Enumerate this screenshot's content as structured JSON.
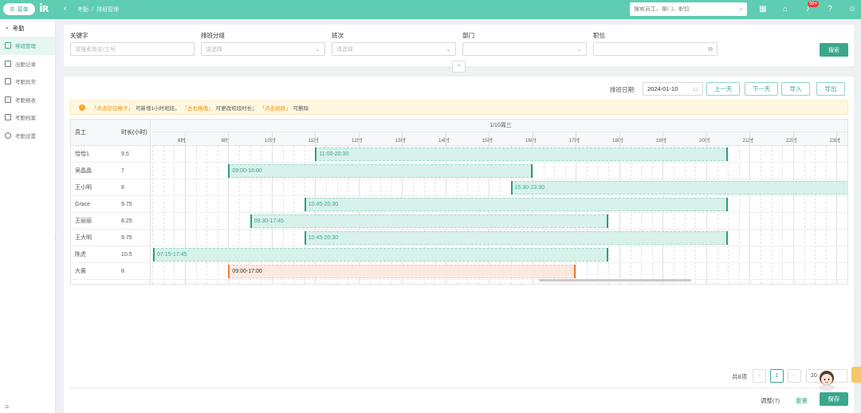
{
  "topbar": {
    "menu_label": "菜单",
    "logo": "i’R",
    "breadcrumb": [
      "考勤",
      "排班管理"
    ],
    "search_placeholder": "搜索员工、部门、职位",
    "notification_count": "99+"
  },
  "sidebar": {
    "section": "考勤",
    "items": [
      {
        "label": "排班管理",
        "active": true
      },
      {
        "label": "出勤记录"
      },
      {
        "label": "考勤异常"
      },
      {
        "label": "考勤报表"
      },
      {
        "label": "考勤档案"
      },
      {
        "label": "考勤设置"
      }
    ]
  },
  "filters": {
    "keyword": {
      "label": "关键字",
      "placeholder": "请搜索姓名/工号"
    },
    "group": {
      "label": "排班分组",
      "placeholder": "请选择"
    },
    "shift": {
      "label": "班次",
      "placeholder": "请选择"
    },
    "department": {
      "label": "部门",
      "placeholder": ""
    },
    "position": {
      "label": "职位",
      "placeholder": ""
    },
    "search_btn": "搜索"
  },
  "toolbar": {
    "date_label": "排班日期:",
    "date_value": "2024-01-10",
    "prev_day": "上一天",
    "next_day": "下一天",
    "import": "导入",
    "export": "导出"
  },
  "tip": {
    "p1": "「点击空白格子」",
    "p2": "可新增1小时班段。",
    "p3": "「左右拖拽」",
    "p4": "可更改班段时长；",
    "p5": "「点击班段」",
    "p6": "可删除"
  },
  "grid": {
    "col_employee": "员工",
    "col_duration": "时长(小时)",
    "date_header": "1/10周三",
    "hours": [
      "8时",
      "9时",
      "10时",
      "11时",
      "12时",
      "13时",
      "14时",
      "15时",
      "16时",
      "17时",
      "18时",
      "19时",
      "20时",
      "21时",
      "22时",
      "23时"
    ],
    "rows": [
      {
        "name": "恰恰1",
        "duration": "9.5",
        "shift": "11:00-20:30",
        "start": 11.0,
        "end": 20.5,
        "color": "green"
      },
      {
        "name": "吴晶晶",
        "duration": "7",
        "shift": "09:00-16:00",
        "start": 9.0,
        "end": 16.0,
        "color": "green"
      },
      {
        "name": "王小明",
        "duration": "8",
        "shift": "15:30-23:30",
        "start": 15.5,
        "end": 23.5,
        "color": "green"
      },
      {
        "name": "Grace",
        "duration": "9.75",
        "shift": "10:45-20:30",
        "start": 10.75,
        "end": 20.5,
        "color": "green"
      },
      {
        "name": "王丽丽",
        "duration": "8.25",
        "shift": "09:30-17:45",
        "start": 9.5,
        "end": 17.75,
        "color": "green"
      },
      {
        "name": "王大明",
        "duration": "9.75",
        "shift": "10:45-20:30",
        "start": 10.75,
        "end": 20.5,
        "color": "green"
      },
      {
        "name": "陈虎",
        "duration": "10.5",
        "shift": "07:15-17:45",
        "start": 7.25,
        "end": 17.75,
        "color": "green"
      },
      {
        "name": "大黄",
        "duration": "8",
        "shift": "09:00-17:00",
        "start": 9.0,
        "end": 17.0,
        "color": "orange"
      }
    ]
  },
  "pagination": {
    "total": "共8项",
    "current": "1",
    "page_size": "20"
  },
  "footer": {
    "adjust": "调整(7)",
    "reset": "重置",
    "save": "保存"
  }
}
